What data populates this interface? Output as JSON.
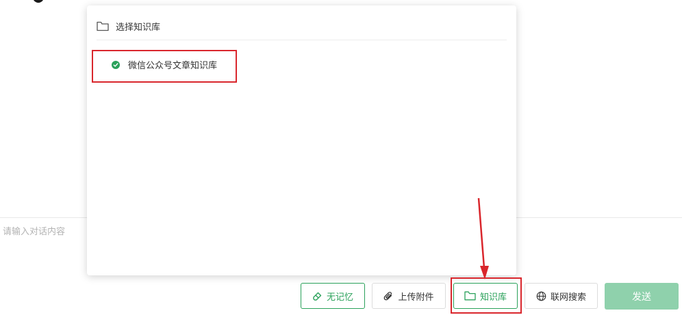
{
  "popup": {
    "title": "选择知识库",
    "knowledge_bases": [
      {
        "label": "微信公众号文章知识库",
        "selected": true
      }
    ]
  },
  "input": {
    "placeholder": "请输入对话内容"
  },
  "toolbar": {
    "no_memory_label": "无记忆",
    "upload_label": "上传附件",
    "knowledge_label": "知识库",
    "web_search_label": "联网搜索",
    "send_label": "发送"
  },
  "colors": {
    "accent": "#2aa15a",
    "send_disabled": "#8fd1ac",
    "annotation": "#d9262c"
  },
  "icons": {
    "popup_header": "folder-icon",
    "selected": "check-circle-icon",
    "no_memory": "eraser-icon",
    "upload": "paperclip-icon",
    "knowledge": "folder-icon",
    "web_search": "globe-icon"
  }
}
